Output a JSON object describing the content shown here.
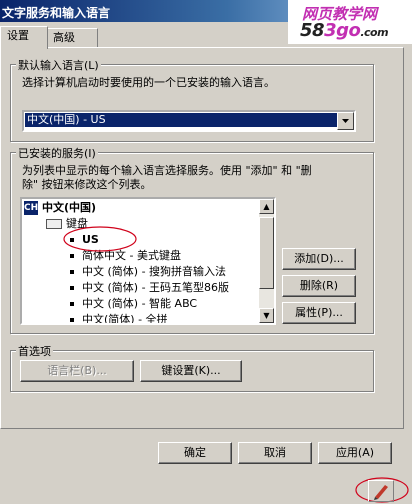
{
  "window": {
    "title": "文字服务和输入语言"
  },
  "watermark": {
    "line1": "网页教学网",
    "line2": "58",
    "line3": "3go",
    "line4": ".com"
  },
  "tabs": [
    {
      "label": "设置",
      "active": true
    },
    {
      "label": "高级",
      "active": false
    }
  ],
  "default_language": {
    "legend": "默认输入语言(L)",
    "description": "选择计算机启动时要使用的一个已安装的输入语言。",
    "selected": "中文(中国) - US"
  },
  "installed_services": {
    "legend": "已安装的服务(I)",
    "description_line1": "为列表中显示的每个输入语言选择服务。使用 \"添加\" 和 \"删",
    "description_line2": "除\" 按钮来修改这个列表。",
    "tree": {
      "language": "中文(中国)",
      "language_icon": "CH",
      "category": "键盘",
      "items": [
        "US",
        "简体中文 - 美式键盘",
        "中文 (简体) - 搜狗拼音输入法",
        "中文 (简体) - 王码五笔型86版",
        "中文 (简体) - 智能 ABC",
        "中文(简体) - 全拼"
      ]
    },
    "buttons": {
      "add": "添加(D)...",
      "remove": "删除(R)",
      "properties": "属性(P)..."
    }
  },
  "preferences": {
    "legend": "首选项",
    "language_bar": "语言栏(B)...",
    "key_settings": "键设置(K)..."
  },
  "dialog_buttons": {
    "ok": "确定",
    "cancel": "取消",
    "apply": "应用(A)"
  },
  "colors": {
    "titlebar": "#0a246a",
    "selection": "#0a246a",
    "face": "#d4d0c8",
    "annotation": "#d0021b"
  }
}
